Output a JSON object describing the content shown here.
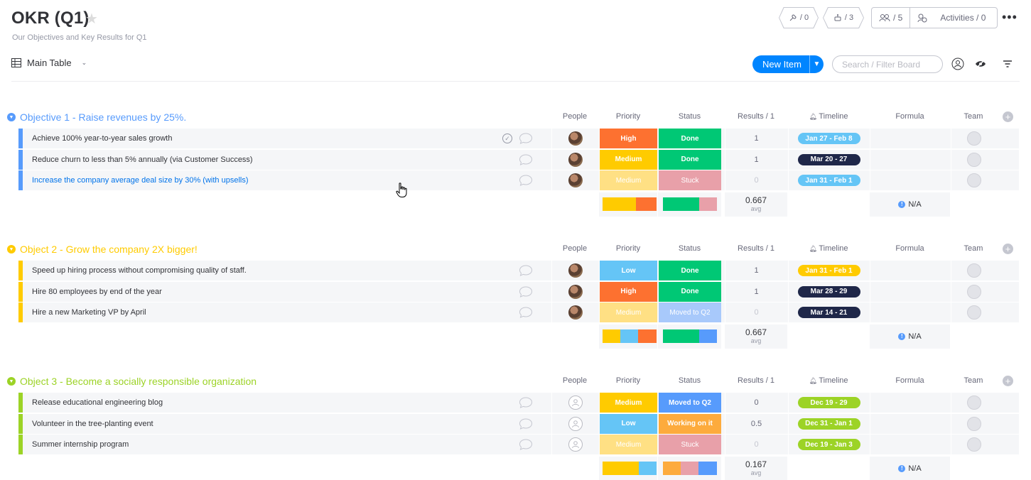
{
  "header": {
    "title": "OKR (Q1)",
    "description": "Our Objectives and Key Results for Q1",
    "integrations_count": "/ 0",
    "automations_count": "/ 3",
    "members_count": "/ 5",
    "activities_label": "Activities / 0"
  },
  "toolbar": {
    "view_label": "Main Table",
    "new_item_label": "New Item",
    "search_placeholder": "Search / Filter Board"
  },
  "columns": {
    "people": "People",
    "priority": "Priority",
    "status": "Status",
    "results": "Results / 1",
    "timeline": "Timeline",
    "formula": "Formula",
    "team": "Team"
  },
  "colors": {
    "blue_group": "#579bfc",
    "yellow_group": "#ffcb00",
    "green_group": "#9cd326",
    "high": "#fd7130",
    "medium": "#ffcb00",
    "medium_pale": "#ffe084",
    "low": "#65c5f6",
    "done": "#00c875",
    "stuck": "#e8a0a9",
    "moved": "#579bfc",
    "moved_pale": "#a8c9fb",
    "working": "#fdab3d",
    "tl_blue": "#65c5f6",
    "tl_dark": "#1f2749",
    "tl_yellow": "#ffcb00",
    "tl_green": "#9cd326"
  },
  "groups": [
    {
      "title": "Objective 1 - Raise revenues by 25%.",
      "items": [
        {
          "name": "Achieve 100% year-to-year sales growth",
          "priority": "High",
          "status": "Done",
          "result": "1",
          "timeline": "Jan 27 - Feb 8"
        },
        {
          "name": "Reduce churn to less than 5% annually (via Customer Success)",
          "priority": "Medium",
          "status": "Done",
          "result": "1",
          "timeline": "Mar 20 - 27"
        },
        {
          "name": "Increase the company average deal size by 30% (with upsells)",
          "priority": "Medium",
          "status": "Stuck",
          "result": "0",
          "timeline": "Jan 31 - Feb 1"
        }
      ],
      "summary": {
        "avg": "0.667",
        "avg_label": "avg",
        "formula": "N/A"
      }
    },
    {
      "title": "Object 2 - Grow the company 2X bigger!",
      "items": [
        {
          "name": "Speed up hiring process without compromising quality of staff.",
          "priority": "Low",
          "status": "Done",
          "result": "1",
          "timeline": "Jan 31 - Feb 1"
        },
        {
          "name": "Hire 80 employees by end of the year",
          "priority": "High",
          "status": "Done",
          "result": "1",
          "timeline": "Mar 28 - 29"
        },
        {
          "name": "Hire a new Marketing VP by April",
          "priority": "Medium",
          "status": "Moved to Q2",
          "result": "0",
          "timeline": "Mar 14 - 21"
        }
      ],
      "summary": {
        "avg": "0.667",
        "avg_label": "avg",
        "formula": "N/A"
      }
    },
    {
      "title": "Object 3 - Become a socially responsible organization",
      "items": [
        {
          "name": "Release educational engineering blog",
          "priority": "Medium",
          "status": "Moved to Q2",
          "result": "0",
          "timeline": "Dec 19 - 29"
        },
        {
          "name": "Volunteer in the tree-planting event",
          "priority": "Low",
          "status": "Working on it",
          "result": "0.5",
          "timeline": "Dec 31 - Jan 1"
        },
        {
          "name": "Summer internship program",
          "priority": "Medium",
          "status": "Stuck",
          "result": "0",
          "timeline": "Dec 19 - Jan 3"
        }
      ],
      "summary": {
        "avg": "0.167",
        "avg_label": "avg",
        "formula": "N/A"
      }
    }
  ]
}
